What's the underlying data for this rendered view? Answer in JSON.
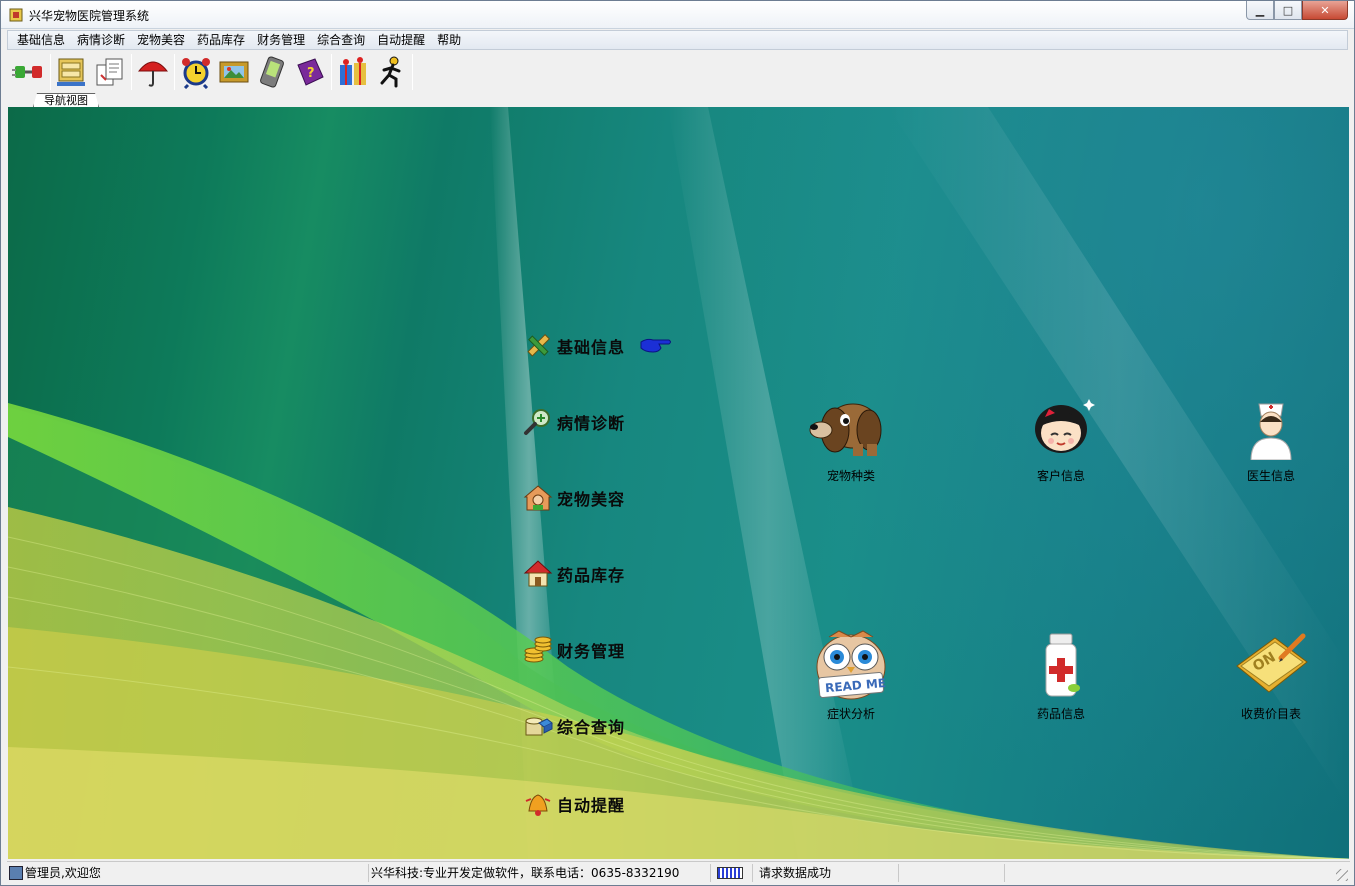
{
  "window": {
    "title": "兴华宠物医院管理系统",
    "buttons": {
      "minimize": "▁",
      "maximize": "□",
      "close": "✕"
    }
  },
  "menubar": {
    "items": [
      "基础信息",
      "病情诊断",
      "宠物美容",
      "药品库存",
      "财务管理",
      "综合查询",
      "自动提醒",
      "帮助"
    ]
  },
  "toolbar": {
    "buttons": [
      "plug-icon",
      "cabinet-icon",
      "documents-icon",
      "umbrella-icon",
      "alarm-clock-icon",
      "picture-icon",
      "pda-icon",
      "help-book-icon",
      "gift-icon",
      "runner-icon"
    ]
  },
  "tabs": {
    "nav_tab": "导航视图"
  },
  "nav": {
    "links": [
      {
        "label": "基础信息",
        "icon": "ruler-pencil-icon"
      },
      {
        "label": "病情诊断",
        "icon": "magnifier-icon"
      },
      {
        "label": "宠物美容",
        "icon": "house-person-icon"
      },
      {
        "label": "药品库存",
        "icon": "red-house-icon"
      },
      {
        "label": "财务管理",
        "icon": "coins-icon"
      },
      {
        "label": "综合查询",
        "icon": "database-icon"
      },
      {
        "label": "自动提醒",
        "icon": "bell-icon"
      }
    ],
    "pointer_icon": "hand-pointer-icon"
  },
  "tiles": [
    {
      "caption": "宠物种类",
      "icon": "dog-icon"
    },
    {
      "caption": "客户信息",
      "icon": "girl-face-icon"
    },
    {
      "caption": "医生信息",
      "icon": "nurse-icon"
    },
    {
      "caption": "症状分析",
      "icon": "owl-readme-icon",
      "badge": "READ ME"
    },
    {
      "caption": "药品信息",
      "icon": "medicine-bottle-icon"
    },
    {
      "caption": "收费价目表",
      "icon": "notepad-on-icon",
      "badge": "ON"
    }
  ],
  "statusbar": {
    "user": "管理员,欢迎您",
    "company": "兴华科技:专业开发定做软件，联系电话：0635-8332190",
    "message": "请求数据成功"
  },
  "colors": {
    "desktop_teal": "#157f85",
    "wave_green": "#6fe34a",
    "wave_yellow": "#e6e86a"
  }
}
